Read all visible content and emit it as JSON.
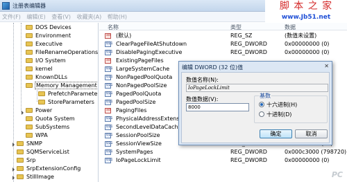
{
  "window": {
    "title": "注册表编辑器"
  },
  "watermark": {
    "line1": "脚 本 之 家",
    "line2": "www.Jb51.net"
  },
  "menu": [
    "文件(F)",
    "编辑(E)",
    "查看(V)",
    "收藏夹(A)",
    "帮助(H)"
  ],
  "tree": {
    "items": [
      "DOS Devices",
      "Environment",
      "Executive",
      "FileRenameOperations",
      "I/O System",
      "kernel",
      "KnownDLLs",
      "Memory Management",
      "PrefetchParameters",
      "StoreParameters",
      "Power",
      "Quota System",
      "SubSystems",
      "WPA",
      "SNMP",
      "SQMServiceList",
      "Srp",
      "SrpExtensionConfig",
      "StillImage"
    ]
  },
  "list": {
    "headers": {
      "name": "名称",
      "type": "类型",
      "data": "数据"
    },
    "rows": [
      {
        "name": "(默认)",
        "type": "REG_SZ",
        "data": "(数值未设置)"
      },
      {
        "name": "ClearPageFileAtShutdown",
        "type": "REG_DWORD",
        "data": "0x00000000 (0)"
      },
      {
        "name": "DisablePagingExecutive",
        "type": "REG_DWORD",
        "data": "0x00000000 (0)"
      },
      {
        "name": "ExistingPageFiles",
        "type": "",
        "data": ""
      },
      {
        "name": "LargeSystemCache",
        "type": "",
        "data": ""
      },
      {
        "name": "NonPagedPoolQuota",
        "type": "",
        "data": ""
      },
      {
        "name": "NonPagedPoolSize",
        "type": "",
        "data": ""
      },
      {
        "name": "PagedPoolQuota",
        "type": "",
        "data": ""
      },
      {
        "name": "PagedPoolSize",
        "type": "",
        "data": ""
      },
      {
        "name": "PagingFiles",
        "type": "",
        "data": ""
      },
      {
        "name": "PhysicalAddressExtension",
        "type": "",
        "data": ""
      },
      {
        "name": "SecondLevelDataCache",
        "type": "",
        "data": ""
      },
      {
        "name": "SessionPoolSize",
        "type": "",
        "data": ""
      },
      {
        "name": "SessionViewSize",
        "type": "REG_DWORD",
        "data": "0x00000030 (48)"
      },
      {
        "name": "SystemPages",
        "type": "REG_DWORD",
        "data": "0x000c3000 (798720)"
      },
      {
        "name": "IoPageLockLimit",
        "type": "REG_DWORD",
        "data": "0x00000000 (0)"
      }
    ]
  },
  "dialog": {
    "title": "编辑 DWORD (32 位)值",
    "close": "✕",
    "name_label": "数值名称(N):",
    "name_value": "IoPageLockLimit",
    "data_label": "数值数据(V):",
    "data_value": "8000",
    "base_legend": "基数",
    "hex_label": "十六进制(H)",
    "dec_label": "十进制(D)",
    "selected_base": "hex",
    "ok": "确定",
    "cancel": "取消"
  },
  "corner_watermark": "PC"
}
